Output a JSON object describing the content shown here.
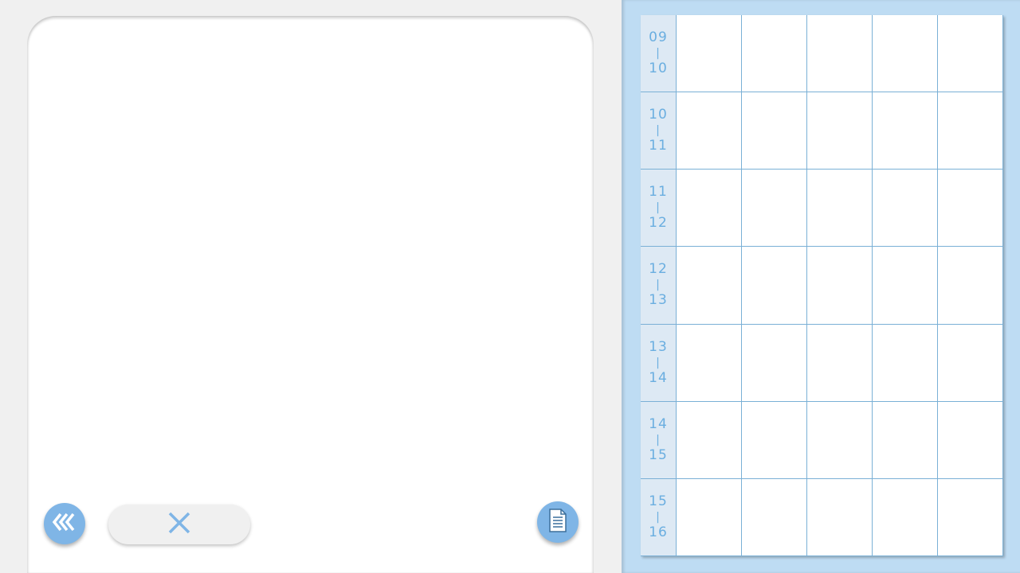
{
  "colors": {
    "accent": "#7fb5e6",
    "panel_bg": "#bedcf3",
    "grid_line": "#7ab0d6",
    "time_text": "#6aaee0",
    "time_col_bg": "#dde9f4"
  },
  "toolbar": {
    "back_icon": "triple-chevron-left-icon",
    "clear_icon": "close-icon",
    "document_icon": "document-icon"
  },
  "schedule": {
    "days_count": 5,
    "rows": [
      {
        "start": "09",
        "sep": "|",
        "end": "10"
      },
      {
        "start": "10",
        "sep": "|",
        "end": "11"
      },
      {
        "start": "11",
        "sep": "|",
        "end": "12"
      },
      {
        "start": "12",
        "sep": "|",
        "end": "13"
      },
      {
        "start": "13",
        "sep": "|",
        "end": "14"
      },
      {
        "start": "14",
        "sep": "|",
        "end": "15"
      },
      {
        "start": "15",
        "sep": "|",
        "end": "16"
      }
    ]
  }
}
